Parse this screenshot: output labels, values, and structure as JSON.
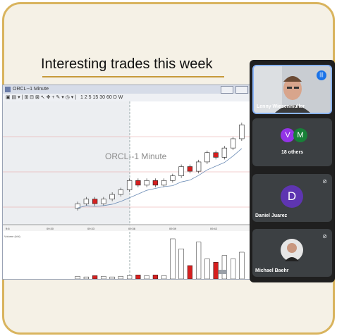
{
  "slide": {
    "title": "Interesting trades this week"
  },
  "chart_window": {
    "title": "ORCL--1 Minute",
    "toolbar_text": "1 2 5 15 30 60 D W",
    "watermark": "ORCL--1 Minute",
    "volume_label": "Volume (Vol)",
    "time_labels": [
      "9:6",
      "09:30",
      "09:33",
      "09:36",
      "09:39",
      "09:42"
    ]
  },
  "chart_data": {
    "type": "candlestick",
    "title": "ORCL--1 Minute",
    "candles": [
      {
        "o": 50,
        "c": 51,
        "color": "white"
      },
      {
        "o": 51,
        "c": 52,
        "color": "white"
      },
      {
        "o": 52,
        "c": 51,
        "color": "red"
      },
      {
        "o": 51,
        "c": 52,
        "color": "white"
      },
      {
        "o": 52,
        "c": 53,
        "color": "white"
      },
      {
        "o": 53,
        "c": 54,
        "color": "white"
      },
      {
        "o": 54,
        "c": 56,
        "color": "white"
      },
      {
        "o": 56,
        "c": 55,
        "color": "red"
      },
      {
        "o": 55,
        "c": 56,
        "color": "white"
      },
      {
        "o": 56,
        "c": 55,
        "color": "red"
      },
      {
        "o": 55,
        "c": 56,
        "color": "white"
      },
      {
        "o": 56,
        "c": 57,
        "color": "white"
      },
      {
        "o": 57,
        "c": 59,
        "color": "white"
      },
      {
        "o": 59,
        "c": 58,
        "color": "red"
      },
      {
        "o": 58,
        "c": 60,
        "color": "white"
      },
      {
        "o": 60,
        "c": 62,
        "color": "white"
      },
      {
        "o": 62,
        "c": 61,
        "color": "red"
      },
      {
        "o": 61,
        "c": 63,
        "color": "white"
      },
      {
        "o": 63,
        "c": 65,
        "color": "white"
      },
      {
        "o": 65,
        "c": 68,
        "color": "white"
      }
    ],
    "volume": [
      4,
      3,
      5,
      4,
      3,
      4,
      5,
      6,
      5,
      6,
      5,
      60,
      45,
      20,
      55,
      30,
      25,
      35,
      30,
      40
    ]
  },
  "participants": {
    "tile1": {
      "name": "Lenny Wiesenmuller"
    },
    "tile2": {
      "avatar1": "V",
      "avatar2": "M",
      "avatar1_color": "#9334e6",
      "avatar2_color": "#188038",
      "label": "18 others"
    },
    "tile3": {
      "avatar": "D",
      "avatar_color": "#5e35b1",
      "name": "Daniel Juarez"
    },
    "tile4": {
      "name": "Michael Baehr"
    },
    "speaking_icon": "audio-wave-icon",
    "muted_icon": "mic-off-icon"
  },
  "colors": {
    "frame_border": "#d9b45e",
    "panel_bg": "#1f1f1f",
    "bear_candle": "#d61f1f"
  }
}
